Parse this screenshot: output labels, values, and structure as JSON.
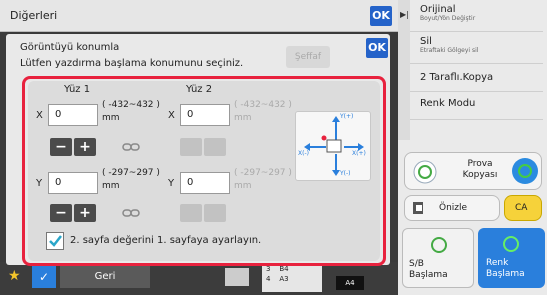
{
  "header": {
    "title": "Diğerleri",
    "ok_label": "OK"
  },
  "dialog": {
    "title": "Görüntüyü konumla",
    "subtitle": "Lütfen yazdırma başlama konumunu seçiniz.",
    "clear_label": "Şeffaf",
    "ok_label": "OK",
    "col1_label": "Yüz 1",
    "col2_label": "Yüz 2",
    "x_label": "X",
    "y_label": "Y",
    "side1": {
      "x_value": "0",
      "y_value": "0",
      "x_range": "( -432~432 )",
      "y_range": "( -297~297 )",
      "unit": "mm"
    },
    "side2": {
      "x_value": "0",
      "y_value": "0",
      "x_range": "( -432~432 )",
      "y_range": "( -297~297 )",
      "unit": "mm"
    },
    "minus": "−",
    "plus": "+",
    "diagram": {
      "y_plus": "Y(+)",
      "y_minus": "Y(-)",
      "x_plus": "X(+)",
      "x_minus": "X(-)"
    },
    "checkbox_label": "2. sayfa değerini 1. sayfaya ayarlayın.",
    "checkbox_checked": true
  },
  "right_panel": {
    "items": [
      {
        "label": "Orijinal",
        "sub": "Boyut/Yön Değiştir"
      },
      {
        "label": "Sil",
        "sub": "Etraftaki Gölgeyi sil"
      },
      {
        "label": "2 Taraflı.Kopya",
        "sub": ""
      },
      {
        "label": "Renk Modu",
        "sub": ""
      }
    ],
    "preview_copy": "Prova Kopyası",
    "preview": "Önizle",
    "ca": "CA",
    "bw_start": "S/B Başlama",
    "color_start": "Renk Başlama"
  },
  "bottom": {
    "back_label": "Geri",
    "tray_rows": [
      {
        "num": "3",
        "size": "B4"
      },
      {
        "num": "4",
        "size": "A3"
      }
    ],
    "paper_size": "A4"
  },
  "colors": {
    "accent": "#2563c9",
    "highlight": "#e8223e",
    "check": "#2aa6c9"
  }
}
